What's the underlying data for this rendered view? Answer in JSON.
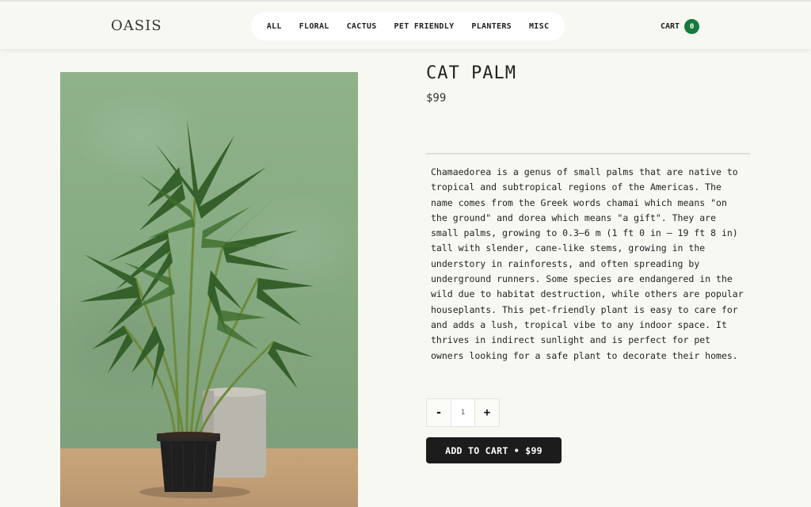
{
  "header": {
    "logo": "OASIS",
    "nav": [
      "ALL",
      "FLORAL",
      "CACTUS",
      "PET FRIENDLY",
      "PLANTERS",
      "MISC"
    ],
    "cart_label": "CART",
    "cart_count": "0",
    "accent_color": "#187a3c"
  },
  "product": {
    "title": "CAT PALM",
    "price": "$99",
    "description": "Chamaedorea is a genus of small palms that are native to tropical and subtropical regions of the Americas. The name comes from the Greek words chamai which means \"on the ground\" and dorea which means \"a gift\". They are small palms, growing to 0.3–6 m (1 ft 0 in – 19 ft 8 in) tall with slender, cane-like stems, growing in the understory in rainforests, and often spreading by underground runners. Some species are endangered in the wild due to habitat destruction, while others are popular houseplants. This pet-friendly plant is easy to care for and adds a lush, tropical vibe to any indoor space. It thrives in indirect sunlight and is perfect for pet owners looking for a safe plant to decorate their homes.",
    "image_icon": "potted-palm-photo"
  },
  "quantity": {
    "decrement_label": "-",
    "value": "1",
    "increment_label": "+"
  },
  "add_to_cart_label": "ADD TO CART • $99"
}
